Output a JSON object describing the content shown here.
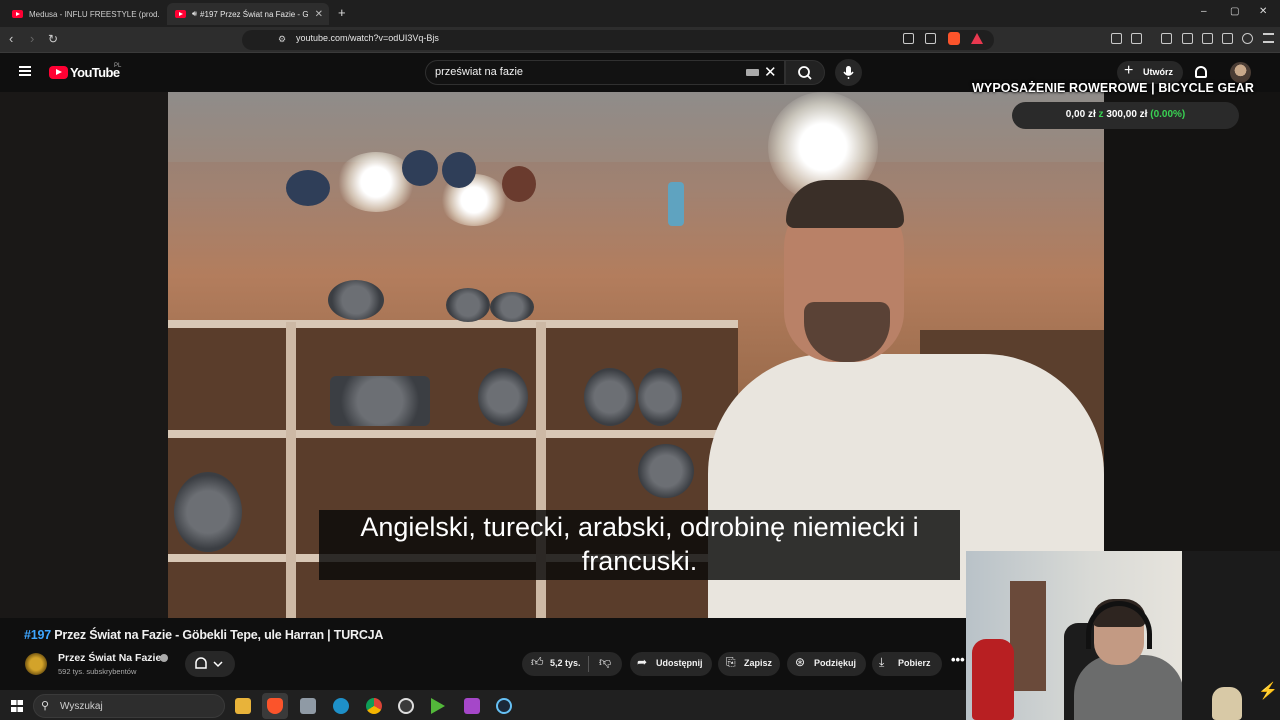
{
  "browser": {
    "tabs": [
      {
        "title": "Medusa - INFLU FREESTYLE (prod. VE",
        "active": false
      },
      {
        "title": "#197 Przez Świat na Fazie - G",
        "active": true
      }
    ],
    "new_tab": "+",
    "window_controls": [
      "–",
      "▢",
      "✕"
    ],
    "url": "youtube.com/watch?v=odUI3Vq-Bjs"
  },
  "youtube": {
    "logo_text": "YouTube",
    "country": "PL",
    "search_value": "przeświat na fazie",
    "create_label": "Utwórz"
  },
  "overlay": {
    "title": "WYPOSAŻENIE ROWEROWE | BICYCLE GEAR",
    "goal_current": "0,00 zł",
    "goal_sep": "z",
    "goal_target": "300,00 zł",
    "goal_percent": "(0.00%)"
  },
  "player": {
    "subtitle_line1": "Angielski, turecki, arabski, odrobinę niemiecki i",
    "subtitle_line2": "francuski."
  },
  "video": {
    "title_number": "#197",
    "title_rest": "Przez Świat na Fazie - Göbekli Tepe, ule Harran | TURCJA",
    "channel_name": "Przez Świat Na Fazie",
    "subscribers": "592 tys. subskrybentów",
    "likes": "5,2 tys.",
    "share_label": "Udostępnij",
    "save_label": "Zapisz",
    "thanks_label": "Podziękuj",
    "download_label": "Pobierz",
    "more": "•••"
  },
  "taskbar": {
    "search_placeholder": "Wyszukaj"
  },
  "colors": {
    "youtube_red": "#ff0033",
    "link_blue": "#3ea6ff",
    "goal_green": "#39d353"
  }
}
